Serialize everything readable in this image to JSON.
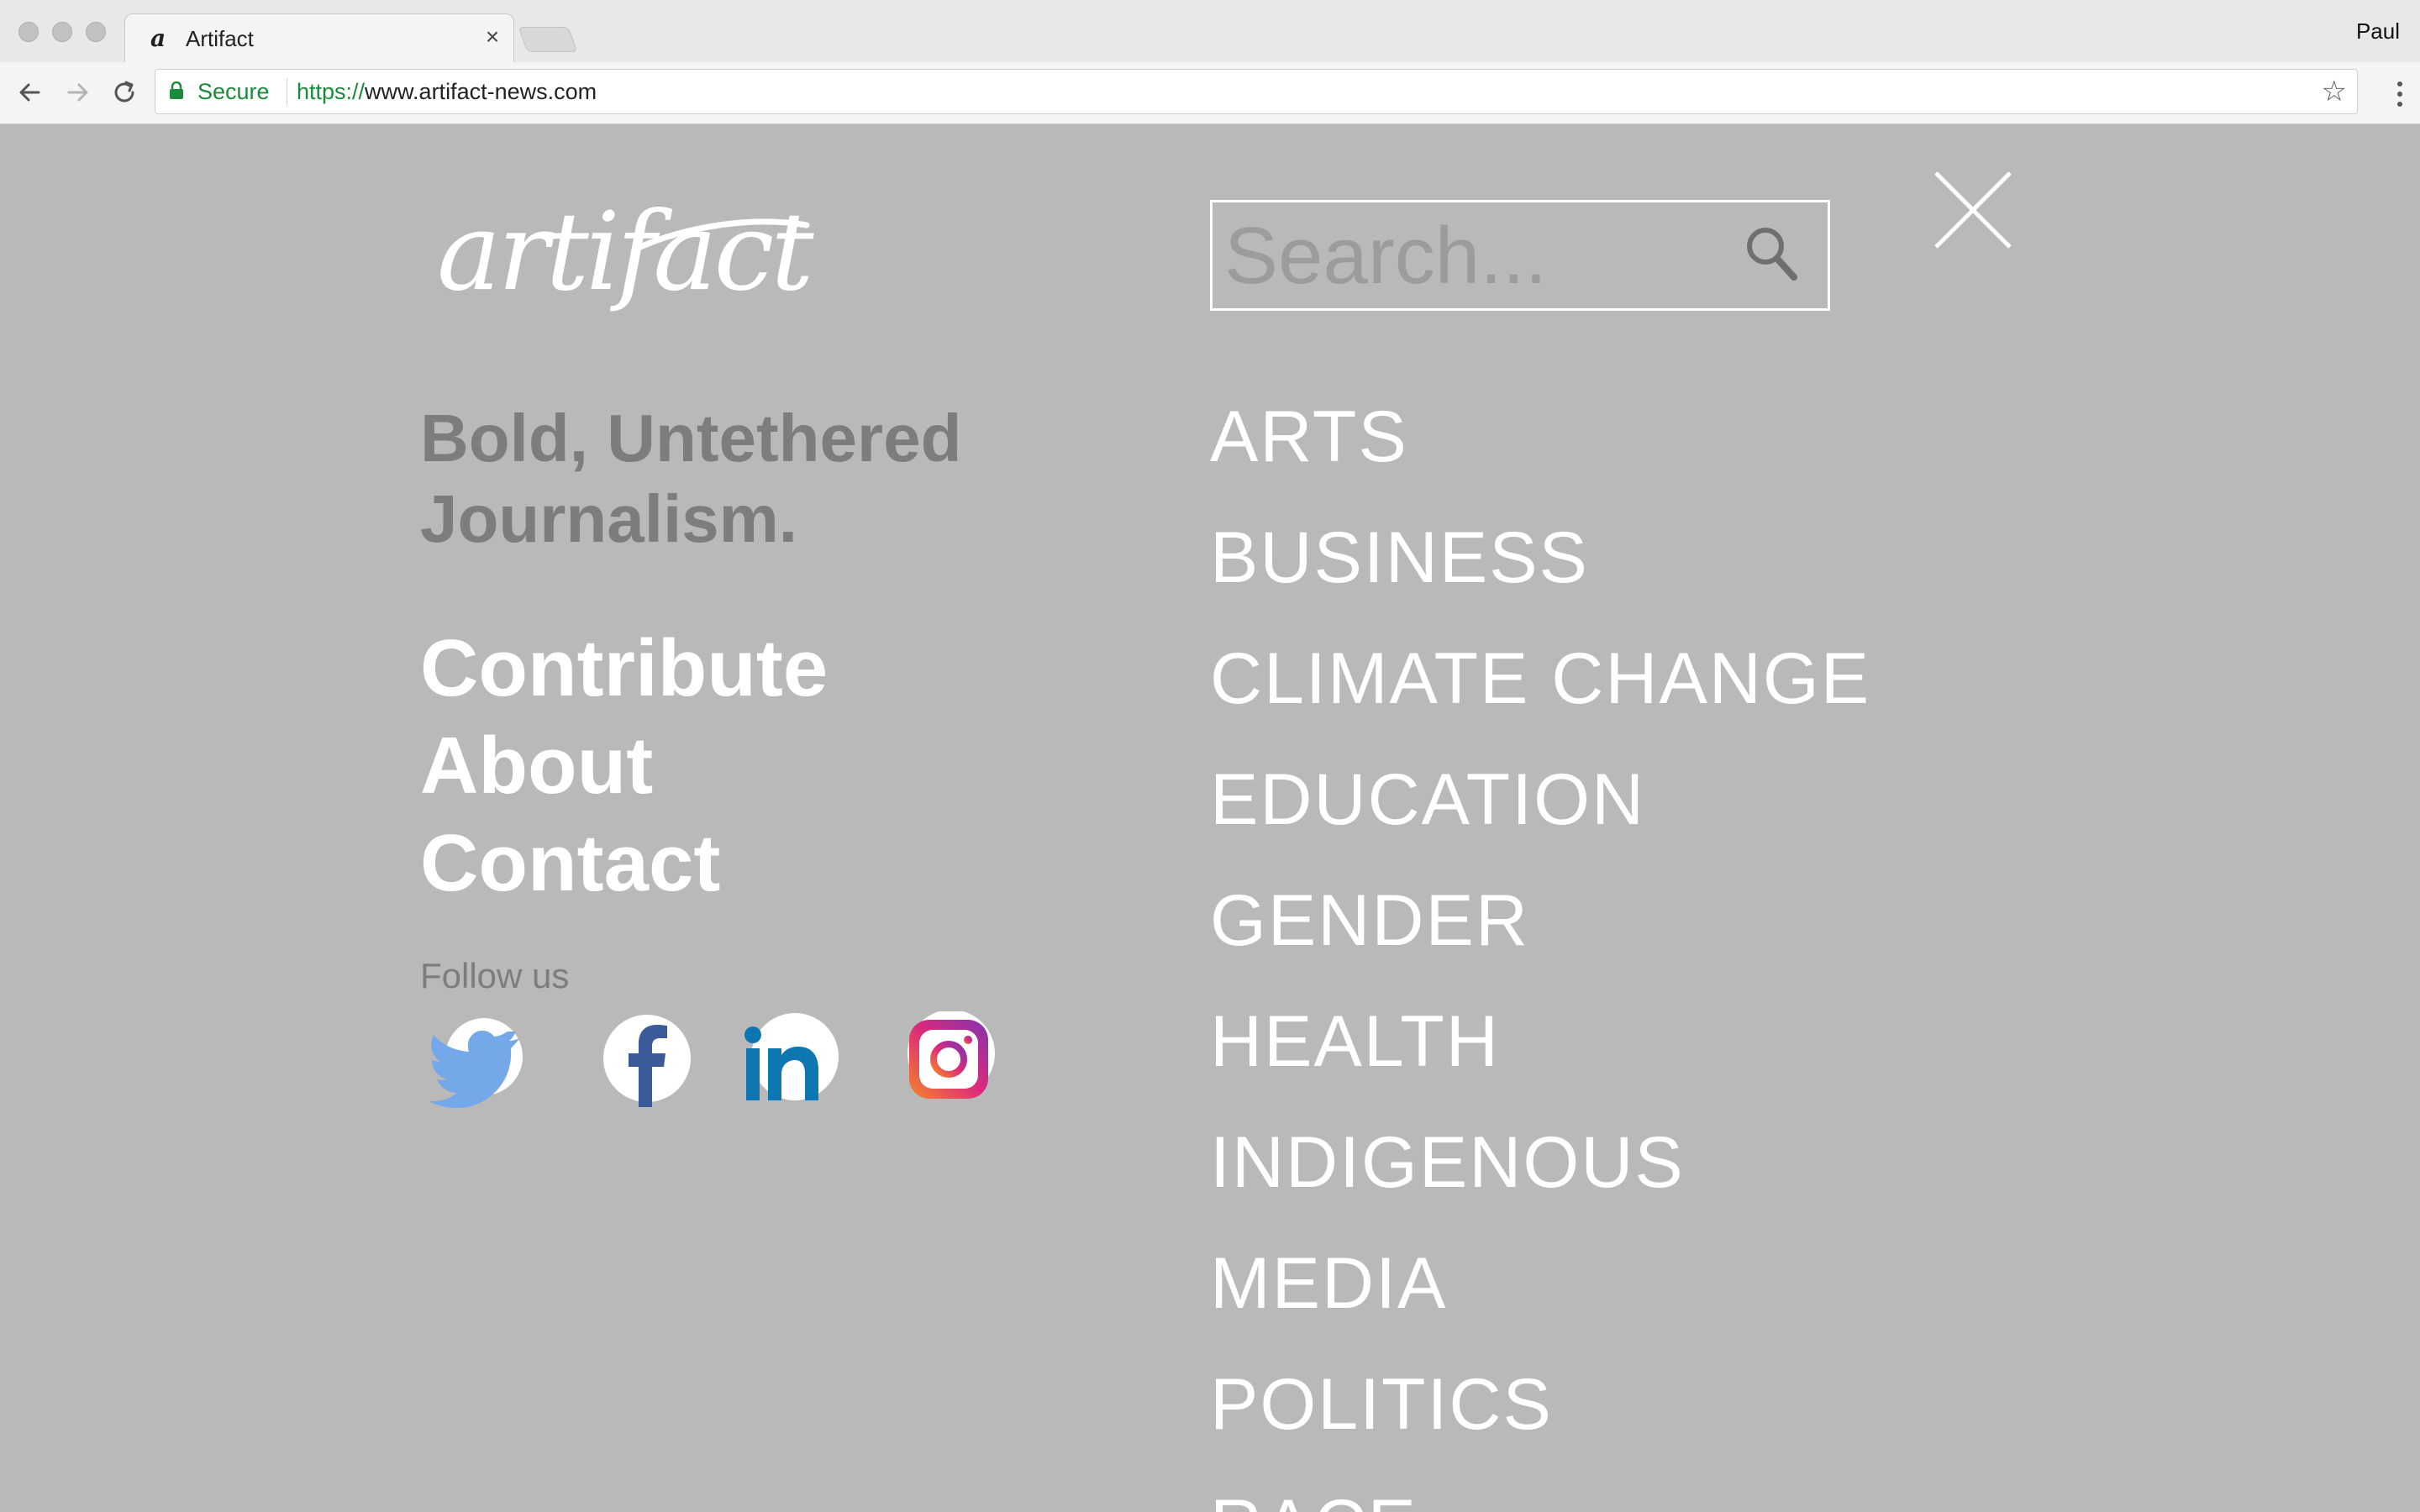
{
  "browser": {
    "tab_title": "Artifact",
    "tab_favicon": "a",
    "tab_close": "×",
    "profile_name": "Paul",
    "secure_label": "Secure",
    "url_scheme": "https://",
    "url_rest": "www.artifact-news.com",
    "bookmark_star": "☆"
  },
  "site": {
    "logo_text": "artifact",
    "search_placeholder": "Search...",
    "tagline": "Bold, Untethered Journalism.",
    "side_links": [
      "Contribute",
      "About",
      "Contact"
    ],
    "follow_label": "Follow us",
    "social": [
      {
        "name": "twitter",
        "color": "#74a8e8"
      },
      {
        "name": "facebook",
        "color": "#3b5a9a"
      },
      {
        "name": "linkedin",
        "color": "#0e76b0"
      },
      {
        "name": "instagram",
        "color": "#c13584"
      }
    ],
    "sections": [
      "ARTS",
      "BUSINESS",
      "CLIMATE CHANGE",
      "EDUCATION",
      "GENDER",
      "HEALTH",
      "INDIGENOUS",
      "MEDIA",
      "POLITICS",
      "RACE"
    ]
  },
  "colors": {
    "overlay_bg": "#b9b9b9",
    "secure_green": "#1b8a3a",
    "muted_text": "#7d7d7d",
    "white": "#ffffff"
  }
}
